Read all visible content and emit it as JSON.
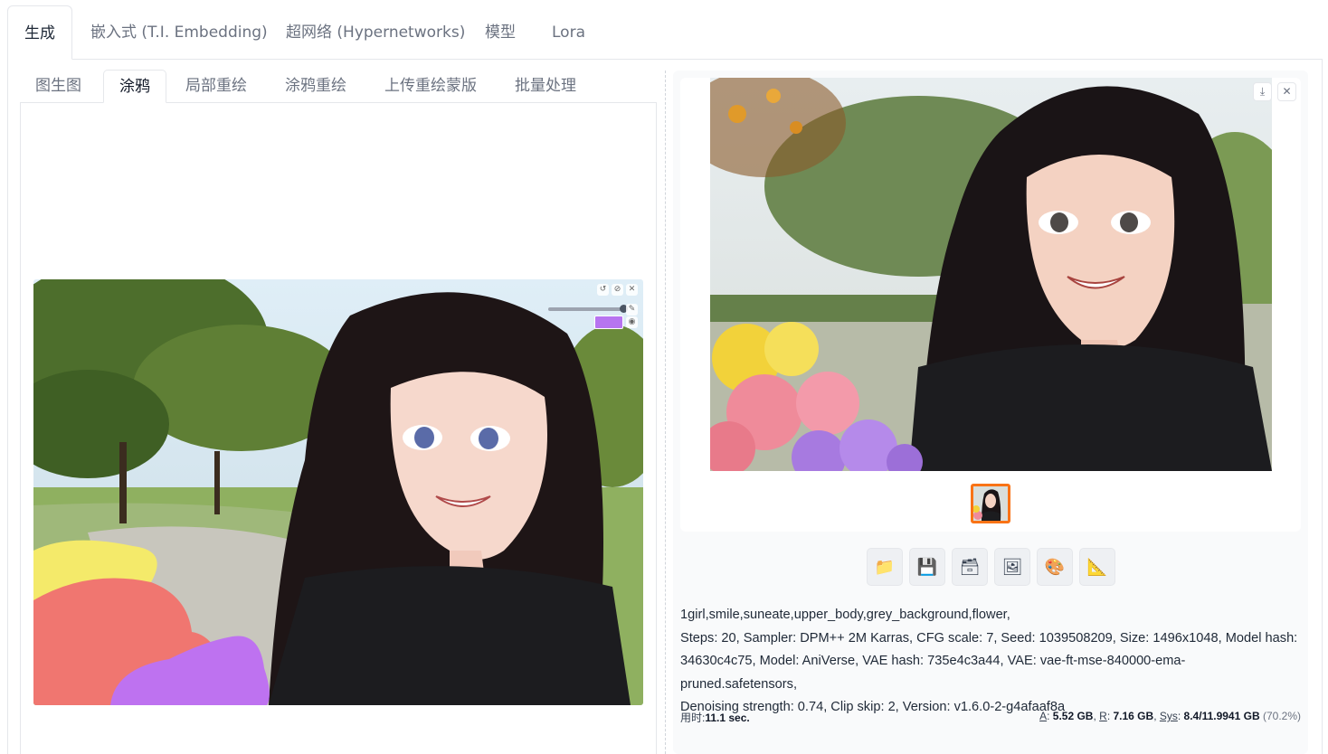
{
  "top_tabs": [
    {
      "label": "生成",
      "active": true
    },
    {
      "label": "嵌入式 (T.I. Embedding)",
      "active": false
    },
    {
      "label": "超网络 (Hypernetworks)",
      "active": false
    },
    {
      "label": "模型",
      "active": false
    },
    {
      "label": "Lora",
      "active": false
    }
  ],
  "sub_tabs": [
    {
      "label": "图生图",
      "active": false
    },
    {
      "label": "涂鸦",
      "active": true
    },
    {
      "label": "局部重绘",
      "active": false
    },
    {
      "label": "涂鸦重绘",
      "active": false
    },
    {
      "label": "上传重绘蒙版",
      "active": false
    },
    {
      "label": "批量处理",
      "active": false
    }
  ],
  "sketch": {
    "brush_color": "#b774f0",
    "stroke_colors": [
      "#f4ea6a",
      "#f07670",
      "#be72f0"
    ]
  },
  "gallery": {
    "download_icon": "download-icon",
    "close_icon": "close-icon"
  },
  "actions": [
    {
      "name": "open-folder-button",
      "icon": "folder-icon",
      "glyph": "📁"
    },
    {
      "name": "save-button",
      "icon": "floppy-icon",
      "glyph": "💾"
    },
    {
      "name": "zip-button",
      "icon": "archive-icon",
      "glyph": "🗃"
    },
    {
      "name": "send-to-img2img-button",
      "icon": "picture-icon",
      "glyph": "🖼"
    },
    {
      "name": "send-to-inpaint-button",
      "icon": "palette-icon",
      "glyph": "🎨"
    },
    {
      "name": "send-to-extras-button",
      "icon": "ruler-triangle-icon",
      "glyph": "📐"
    }
  ],
  "info": {
    "prompt": "1girl,smile,suneate,upper_body,grey_background,flower,",
    "params_line1": "Steps: 20, Sampler: DPM++ 2M Karras, CFG scale: 7, Seed: 1039508209, Size: 1496x1048, Model hash:",
    "params_line2": "34630c4c75, Model: AniVerse, VAE hash: 735e4c3a44, VAE: vae-ft-mse-840000-ema-pruned.safetensors,",
    "params_line3": "Denoising strength: 0.74, Clip skip: 2, Version: v1.6.0-2-g4afaaf8a"
  },
  "footer": {
    "time_label": "用时:",
    "time_value": "11.1 sec.",
    "a_label": "A",
    "a_value": "5.52 GB",
    "r_label": "R",
    "r_value": "7.16 GB",
    "sys_label": "Sys",
    "sys_value": "8.4/11.9941 GB",
    "sys_pct": "(70.2%)"
  }
}
